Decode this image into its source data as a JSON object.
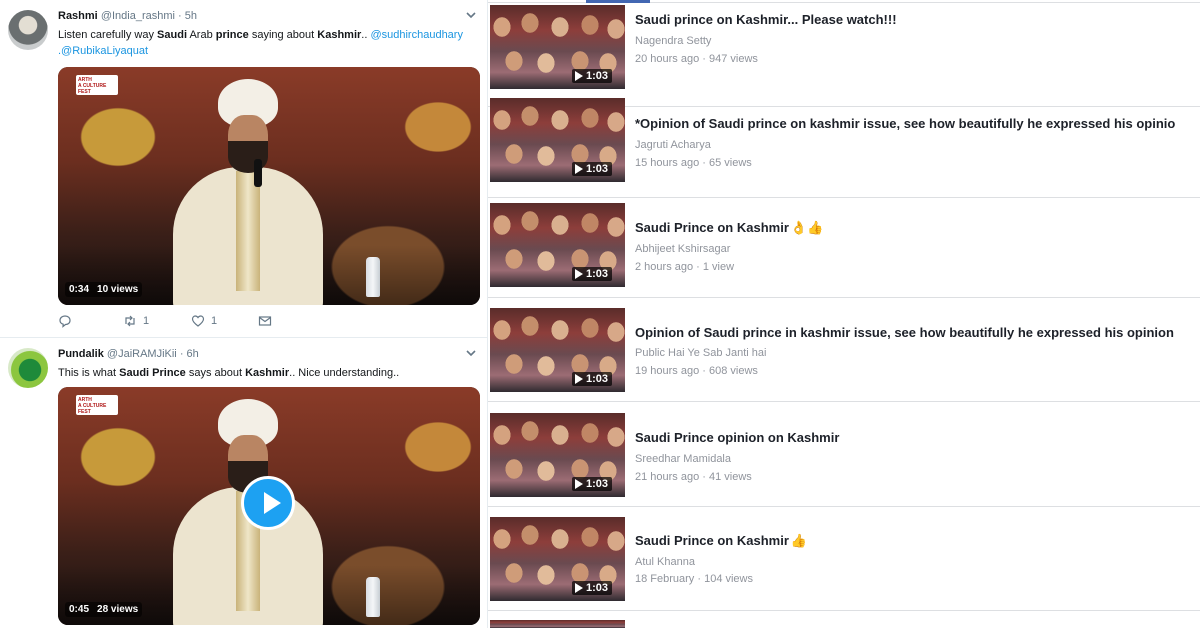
{
  "twitter": {
    "tweets": [
      {
        "name": "Rashmi",
        "handle": "@India_rashmi",
        "time": "· 5h",
        "text": {
          "t1": "Listen carefully way ",
          "b1": "Saudi",
          "t2": " Arab ",
          "b2": "prince",
          "t3": " saying about ",
          "b3": "Kashmir",
          "t4": ".. ",
          "mention1": "@sudhirchaudhary",
          "mention2": ".@RubikaLiyaquat"
        },
        "video": {
          "duration": "0:34",
          "views": "10 views",
          "logo_line1": "ARTH",
          "logo_line2": "A CULTURE",
          "logo_line3": "FEST"
        },
        "actions": {
          "replies": "",
          "retweets": "1",
          "likes": "1"
        }
      },
      {
        "name": "Pundalik",
        "handle": "@JaiRAMJiKii",
        "time": "· 6h",
        "text": {
          "t1": "This is what ",
          "b1": "Saudi Prince",
          "t2": " says about ",
          "b2": "Kashmir",
          "t3": ".. Nice understanding.."
        },
        "video": {
          "duration": "0:45",
          "views": "28 views",
          "logo_line1": "ARTH",
          "logo_line2": "A CULTURE",
          "logo_line3": "FEST"
        }
      }
    ],
    "icons": {
      "reply": "reply-icon",
      "retweet": "retweet-icon",
      "like": "heart-icon",
      "dm": "envelope-icon",
      "caret": "chevron-down-icon",
      "play": "play-icon"
    },
    "link_color": "#1b95e0"
  },
  "facebook": {
    "accent_color": "#4267b2",
    "results": [
      {
        "title": "Saudi prince on Kashmir... Please watch!!!",
        "emoji": "",
        "author": "Nagendra Setty",
        "meta": "20 hours ago · 947 views",
        "duration": "1:03"
      },
      {
        "title": "*Opinion of Saudi prince on kashmir issue, see how beautifully he expressed his opinio",
        "emoji": "",
        "author": "Jagruti Acharya",
        "meta": "15 hours ago · 65 views",
        "duration": "1:03"
      },
      {
        "title": "Saudi Prince on Kashmir",
        "emoji": "👌👍",
        "author": "Abhijeet Kshirsagar",
        "meta": "2 hours ago · 1 view",
        "duration": "1:03"
      },
      {
        "title": "Opinion of Saudi prince in kashmir issue, see how beautifully he expressed his opinion",
        "emoji": "",
        "author": "Public Hai Ye Sab Janti hai",
        "meta": "19 hours ago · 608 views",
        "duration": "1:03"
      },
      {
        "title": "Saudi Prince opinion on Kashmir",
        "emoji": "",
        "author": "Sreedhar Mamidala",
        "meta": "21 hours ago · 41 views",
        "duration": "1:03"
      },
      {
        "title": "Saudi Prince on Kashmir",
        "emoji": "👍",
        "author": "Atul Khanna",
        "meta": "18 February · 104 views",
        "duration": "1:03"
      }
    ]
  }
}
